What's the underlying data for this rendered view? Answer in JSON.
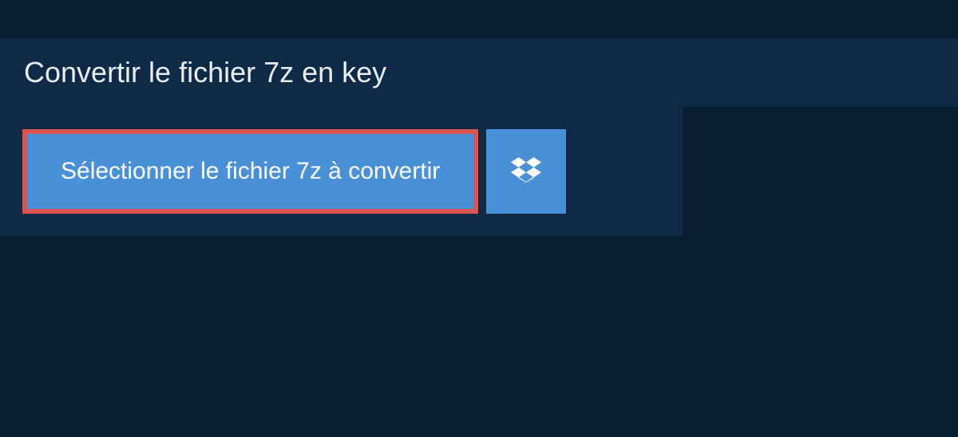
{
  "header": {
    "title": "Convertir le fichier 7z en key"
  },
  "actions": {
    "select_file_label": "Sélectionner le fichier 7z à convertir",
    "dropbox_label": "Dropbox"
  },
  "colors": {
    "background": "#0a1f33",
    "panel": "#0e2a47",
    "button": "#4a90d9",
    "highlight_border": "#d9534f",
    "text_light": "#ffffff"
  }
}
